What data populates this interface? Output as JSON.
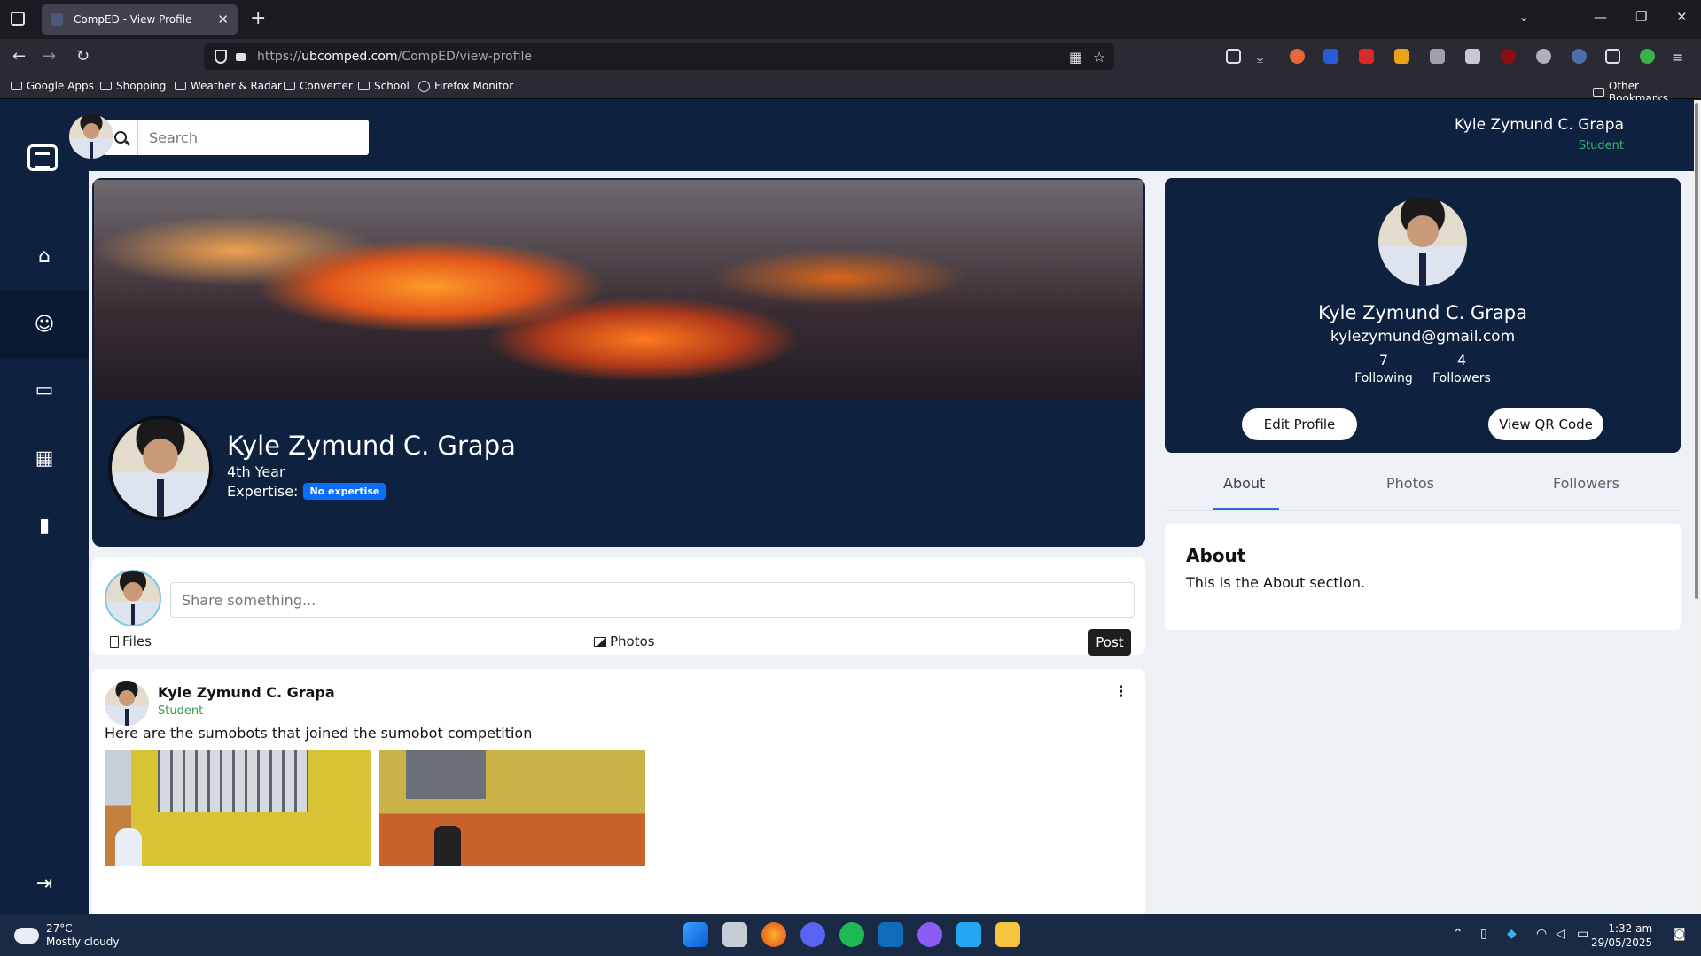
{
  "browser": {
    "tab_title": "CompED - View Profile",
    "tab_close": "✕",
    "new_tab": "+",
    "url_prefix": "https://",
    "url_host": "ubcomped.com",
    "url_path": "/CompED/view-profile",
    "bookmarks": [
      {
        "label": "Google Apps",
        "icon": "folder-icon"
      },
      {
        "label": "Shopping",
        "icon": "folder-icon"
      },
      {
        "label": "Weather & Radar",
        "icon": "folder-icon"
      },
      {
        "label": "Converter",
        "icon": "folder-icon"
      },
      {
        "label": "School",
        "icon": "folder-icon"
      },
      {
        "label": "Firefox Monitor",
        "icon": "globe-icon"
      }
    ],
    "other_bookmarks": "Other Bookmarks"
  },
  "topbar": {
    "search_placeholder": "Search",
    "user_name": "Kyle Zymund C. Grapa",
    "user_role": "Student"
  },
  "sidebar": {
    "items": [
      {
        "name": "home",
        "icon": "home-icon"
      },
      {
        "name": "profile",
        "icon": "user-icon",
        "active": true
      },
      {
        "name": "messages",
        "icon": "chat-icon"
      },
      {
        "name": "calendar",
        "icon": "calendar-icon"
      },
      {
        "name": "book",
        "icon": "book-icon"
      }
    ],
    "logout_icon": "logout-icon"
  },
  "profile": {
    "name": "Kyle Zymund C. Grapa",
    "year": "4th Year",
    "expertise_label": "Expertise:",
    "expertise_badge": "No expertise"
  },
  "share": {
    "placeholder": "Share something...",
    "files_label": "Files",
    "photos_label": "Photos",
    "post_label": "Post"
  },
  "post": {
    "author": "Kyle Zymund C. Grapa",
    "role": "Student",
    "menu": "⋮",
    "text": "Here are the sumobots that joined the sumobot competition"
  },
  "profile_card": {
    "name": "Kyle Zymund C. Grapa",
    "email": "kylezymund@gmail.com",
    "following_count": "7",
    "following_label": "Following",
    "followers_count": "4",
    "followers_label": "Followers",
    "edit_button": "Edit Profile",
    "qr_button": "View QR Code"
  },
  "tabs": {
    "about": "About",
    "photos": "Photos",
    "followers": "Followers",
    "active": "About"
  },
  "about": {
    "title": "About",
    "text": "This is the About section."
  },
  "taskbar": {
    "temperature": "27°C",
    "condition": "Mostly cloudy",
    "time": "1:32 am",
    "date": "29/05/2025"
  },
  "colors": {
    "navy": "#0e2240",
    "badge_blue": "#0d6efd",
    "student_green": "#35b86a",
    "tab_underline": "#2a6fd6"
  }
}
